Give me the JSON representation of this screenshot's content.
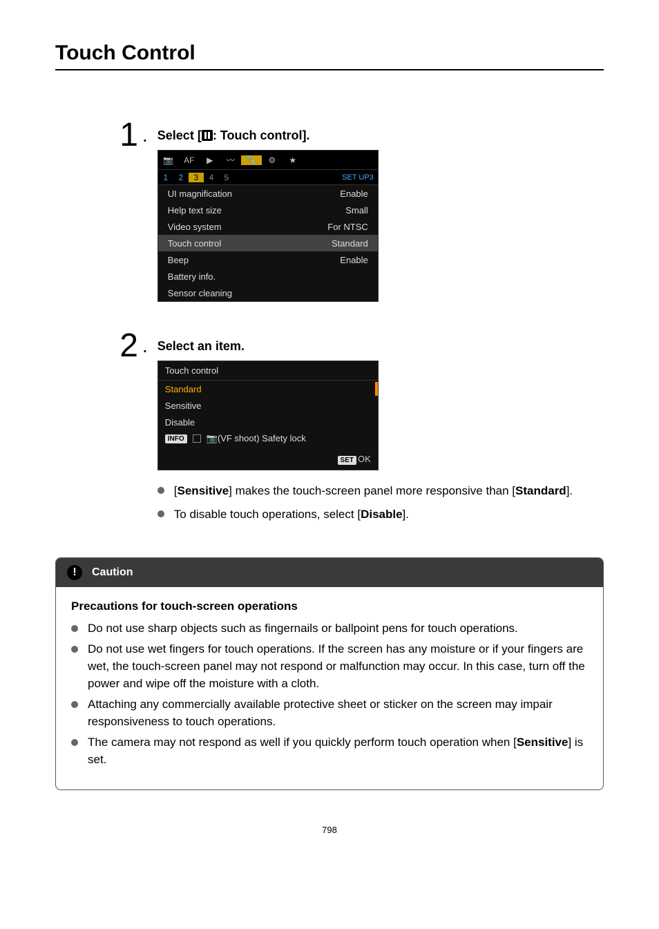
{
  "page_title": "Touch Control",
  "step1": {
    "num": "1",
    "heading_prefix": "Select [",
    "heading_suffix": ": Touch control].",
    "tabs": [
      "📷",
      "AF",
      "▶",
      "〰",
      "🔧",
      "⚙",
      "★"
    ],
    "subtabs": [
      "1",
      "2",
      "3",
      "4",
      "5"
    ],
    "subtabs_right": "SET UP3",
    "rows": [
      {
        "label": "UI magnification",
        "value": "Enable"
      },
      {
        "label": "Help text size",
        "value": "Small"
      },
      {
        "label": "Video system",
        "value": "For NTSC"
      },
      {
        "label": "Touch control",
        "value": "Standard",
        "selected": true
      },
      {
        "label": "Beep",
        "value": "Enable"
      },
      {
        "label": "Battery info.",
        "value": ""
      },
      {
        "label": "Sensor cleaning",
        "value": ""
      }
    ]
  },
  "step2": {
    "num": "2",
    "heading": "Select an item.",
    "panel_title": "Touch control",
    "options": [
      "Standard",
      "Sensitive",
      "Disable"
    ],
    "info_label": "INFO",
    "info_text": "📷(VF shoot) Safety lock",
    "set_label": "SET",
    "ok_label": "OK",
    "bullets": [
      {
        "pre": "[",
        "b1": "Sensitive",
        "mid": "] makes the touch-screen panel more responsive than [",
        "b2": "Standard",
        "post": "]."
      },
      {
        "plain_pre": "To disable touch operations, select [",
        "b1": "Disable",
        "plain_post": "]."
      }
    ]
  },
  "caution": {
    "heading": "Caution",
    "subheading": "Precautions for touch-screen operations",
    "items": [
      "Do not use sharp objects such as fingernails or ballpoint pens for touch operations.",
      "Do not use wet fingers for touch operations. If the screen has any moisture or if your fingers are wet, the touch-screen panel may not respond or malfunction may occur. In this case, turn off the power and wipe off the moisture with a cloth.",
      "Attaching any commercially available protective sheet or sticker on the screen may impair responsiveness to touch operations.",
      {
        "pre": "The camera may not respond as well if you quickly perform touch operation when [",
        "b": "Sensitive",
        "post": "] is set."
      }
    ]
  },
  "page_number": "798"
}
